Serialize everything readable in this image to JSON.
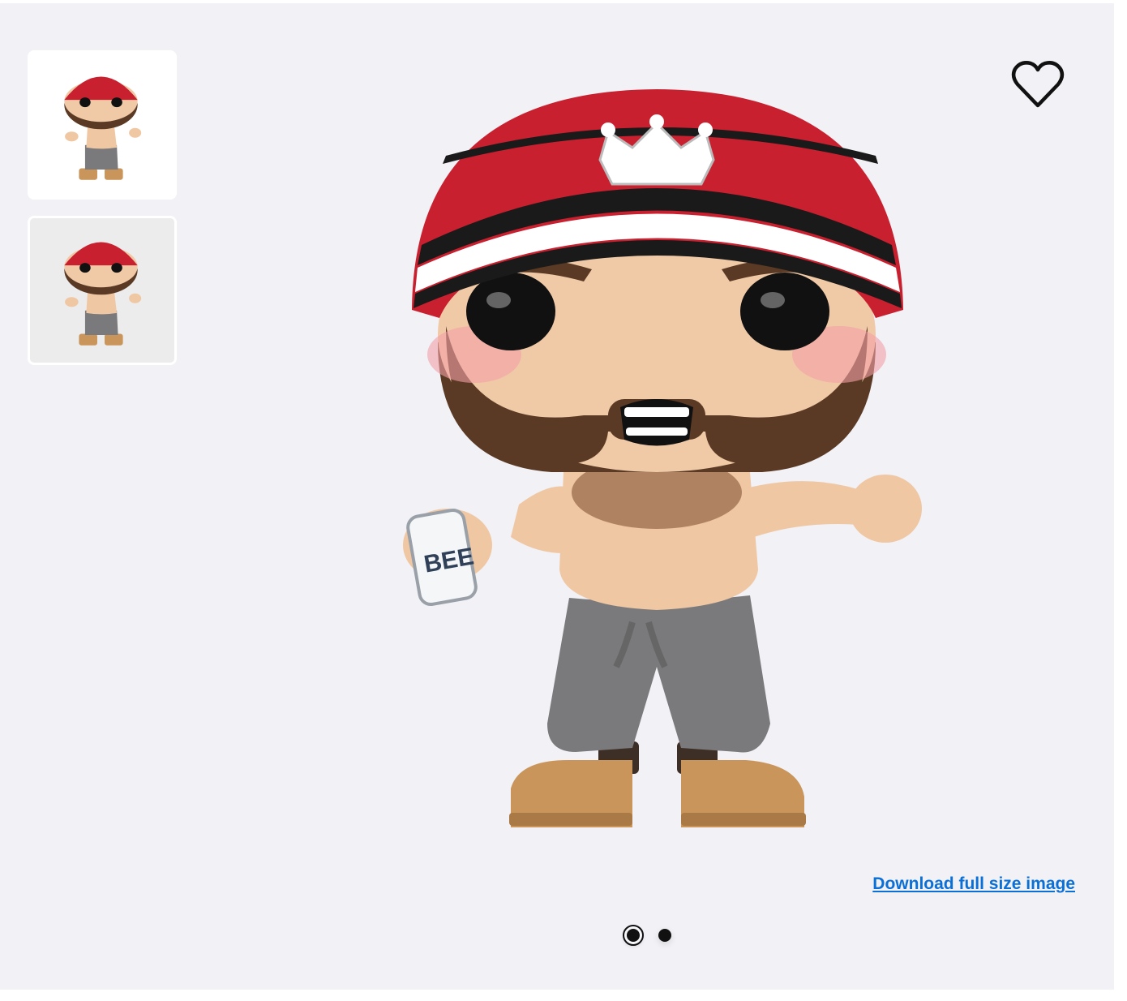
{
  "gallery": {
    "thumbnails": [
      {
        "name": "thumbnail-front",
        "selected": true,
        "background": "#ffffff"
      },
      {
        "name": "thumbnail-alt",
        "selected": false,
        "background": "#ececec"
      }
    ],
    "main_image": {
      "can_label": "BEE",
      "colors": {
        "beanie_red": "#c9202f",
        "beanie_stripe_white": "#ffffff",
        "beanie_stripe_black": "#1a1a1a",
        "skin": "#f0c9a6",
        "beard": "#5a3a24",
        "pants": "#7a7a7c",
        "boots": "#c9955a"
      }
    },
    "favorite_icon": "heart-outline-icon",
    "download_link_text": "Download full size image",
    "pagination": {
      "total": 2,
      "active_index": 0
    }
  }
}
